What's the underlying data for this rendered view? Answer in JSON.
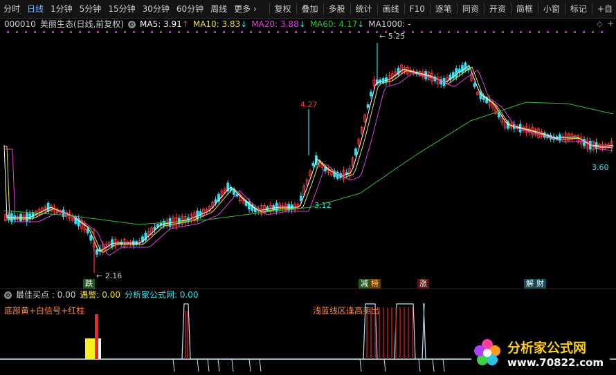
{
  "toolbar": {
    "left": [
      "分时",
      "日线",
      "1分钟",
      "5分钟",
      "15分钟",
      "30分钟",
      "60分钟",
      "周线",
      "更多 ›"
    ],
    "right": [
      "复权",
      "叠加",
      "多股",
      "统计",
      "画线",
      "F10",
      "逐笔",
      "同资",
      "开资",
      "简框",
      "小窗",
      "标记",
      "+自"
    ]
  },
  "ma_row": {
    "code": "000010",
    "name": "美丽生态(日线,前复权)",
    "ma5": "MA5: 3.91",
    "ma5_arrow": "↑",
    "ma10": "MA10: 3.83",
    "ma10_arrow": "↓",
    "ma20": "MA20: 3.88",
    "ma20_arrow": "↓",
    "ma60": "MA60: 4.17",
    "ma60_arrow": "↓",
    "ma1000": "MA1000: -"
  },
  "annotations": {
    "high": "← 5.25",
    "peak1": "4.27",
    "low1": "← 2.16",
    "low2": "3.12",
    "last": "3.60"
  },
  "events": {
    "e1": "跌",
    "e2": "减",
    "e3": "榜",
    "e4": "涨",
    "e5": "解",
    "e6": "财"
  },
  "indicator": {
    "best_buy": "最佳买点 : 0.00",
    "alert": "遇警: 0.00",
    "site": "分析家公式网: 0.00",
    "legend1": "底部黄+白信号+红柱",
    "legend2": "浅蓝线区逢高卖出"
  },
  "logo": {
    "title": "分析家公式网",
    "url": "www.70822.com"
  },
  "colors": {
    "up": "#ff3b3b",
    "down": "#2fe0f0",
    "ma5": "#ffffff",
    "ma10": "#f0e040",
    "ma20": "#e040e0",
    "ma60": "#30c030",
    "accent": "#6fb3ff"
  }
}
